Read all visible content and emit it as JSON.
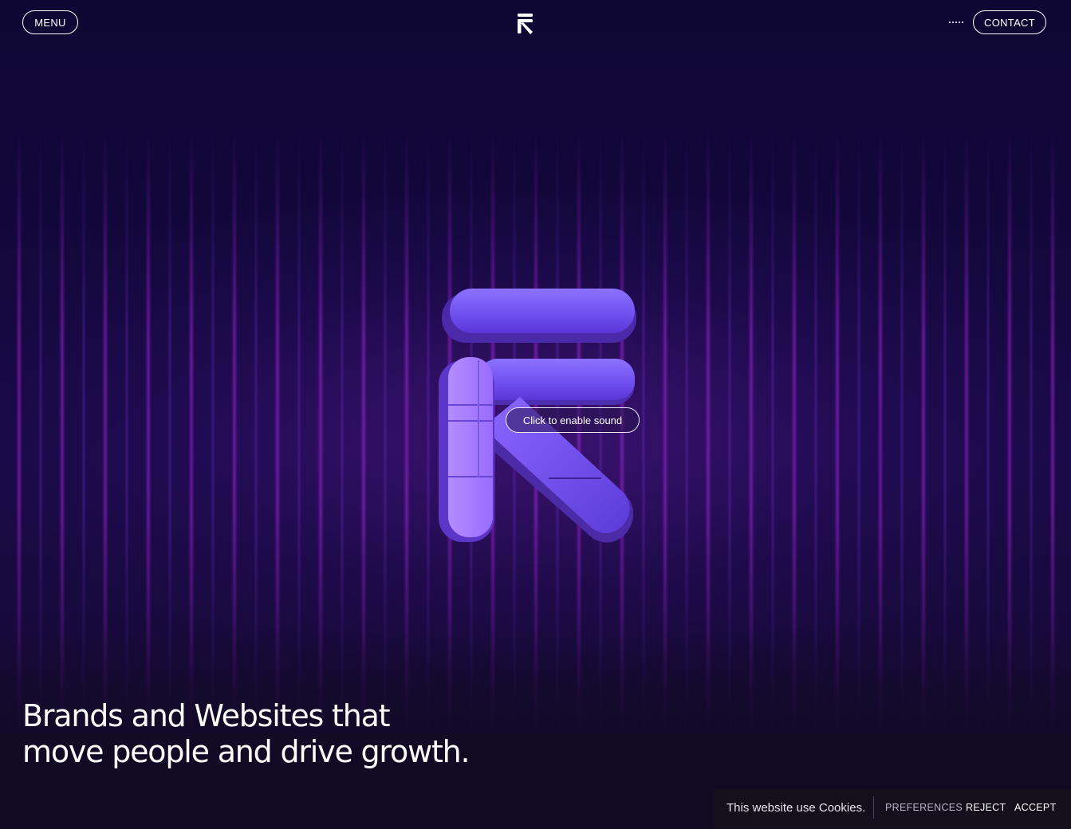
{
  "header": {
    "menu_label": "MENU",
    "contact_label": "CONTACT",
    "logo_icon": "brand-arrow-logo-icon",
    "sound_toggle_icon": "dashed-sound-icon"
  },
  "hero": {
    "mark_icon": "3d-brand-arrow-mark",
    "sound_prompt": "Click to enable sound",
    "headline_line1": "Brands and Websites that",
    "headline_line2": "move people and drive growth."
  },
  "cookie_banner": {
    "message": "This website use Cookies.",
    "preferences_label": "PREFERENCES",
    "reject_label": "REJECT",
    "accept_label": "ACCEPT"
  },
  "colors": {
    "background": "#0d0630",
    "accent_purple": "#7b5cff",
    "streak_magenta": "#b028e6",
    "text": "#ffffff"
  }
}
